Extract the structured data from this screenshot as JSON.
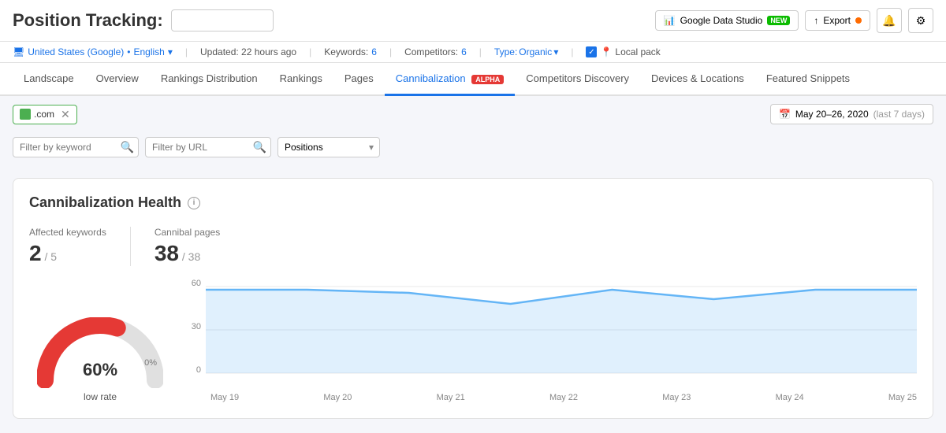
{
  "header": {
    "title": "Position Tracking:",
    "title_input_placeholder": "",
    "gds_label": "Google Data Studio",
    "gds_badge": "NEW",
    "export_label": "Export",
    "bell_icon": "🔔",
    "settings_icon": "⚙"
  },
  "sub_bar": {
    "location": "United States (Google)",
    "language": "English",
    "updated": "Updated: 22 hours ago",
    "keywords_label": "Keywords:",
    "keywords_count": "6",
    "competitors_label": "Competitors:",
    "competitors_count": "6",
    "type_label": "Type:",
    "type_value": "Organic",
    "local_pack": "Local pack"
  },
  "nav": {
    "tabs": [
      {
        "label": "Landscape",
        "active": false
      },
      {
        "label": "Overview",
        "active": false
      },
      {
        "label": "Rankings Distribution",
        "active": false
      },
      {
        "label": "Rankings",
        "active": false
      },
      {
        "label": "Pages",
        "active": false
      },
      {
        "label": "Cannibalization",
        "active": true,
        "badge": "ALPHA"
      },
      {
        "label": "Competitors Discovery",
        "active": false
      },
      {
        "label": "Devices & Locations",
        "active": false
      },
      {
        "label": "Featured Snippets",
        "active": false
      }
    ]
  },
  "filter_bar": {
    "domain_text": ".com",
    "date_range": "May 20–26, 2020",
    "date_suffix": "(last 7 days)"
  },
  "search_row": {
    "keyword_placeholder": "Filter by keyword",
    "url_placeholder": "Filter by URL",
    "positions_label": "Positions"
  },
  "card": {
    "title": "Cannibalization Health",
    "metrics": {
      "affected_keywords_label": "Affected keywords",
      "affected_value": "2",
      "affected_total": "5",
      "cannibal_pages_label": "Cannibal pages",
      "cannibal_value": "38",
      "cannibal_total": "38"
    },
    "gauge": {
      "percentage": "60%",
      "zero_label": "0%",
      "rate_label": "low rate"
    },
    "chart": {
      "y_labels": [
        "60",
        "30",
        "0"
      ],
      "x_labels": [
        "May 19",
        "May 20",
        "May 21",
        "May 22",
        "May 23",
        "May 24",
        "May 25"
      ],
      "data_points": [
        59,
        59,
        58,
        54,
        59,
        56,
        60,
        59
      ],
      "accent_color": "#64b5f6",
      "fill_color": "rgba(100,181,246,0.2)"
    }
  }
}
